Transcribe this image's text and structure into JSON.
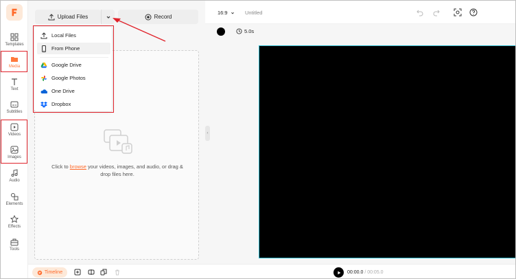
{
  "rail": {
    "items": [
      {
        "label": "Templates",
        "icon": "templates-icon"
      },
      {
        "label": "Media",
        "icon": "folder-icon"
      },
      {
        "label": "Text",
        "icon": "text-icon"
      },
      {
        "label": "Subtitles",
        "icon": "subtitles-icon"
      },
      {
        "label": "Videos",
        "icon": "video-icon"
      },
      {
        "label": "Images",
        "icon": "image-icon"
      },
      {
        "label": "Audio",
        "icon": "music-icon"
      },
      {
        "label": "Elements",
        "icon": "elements-icon"
      },
      {
        "label": "Effects",
        "icon": "effects-icon"
      },
      {
        "label": "Tools",
        "icon": "tools-icon"
      }
    ],
    "active": "Media"
  },
  "panel": {
    "upload_label": "Upload Files",
    "record_label": "Record",
    "drop_prefix": "Click to ",
    "drop_link": "browse",
    "drop_suffix": " your videos, images, and audio, or drag & drop files here."
  },
  "menu": {
    "items": [
      {
        "label": "Local Files",
        "icon": "upload-icon"
      },
      {
        "label": "From Phone",
        "icon": "phone-icon"
      },
      {
        "label": "Google Drive",
        "icon": "google-drive-icon"
      },
      {
        "label": "Google Photos",
        "icon": "google-photos-icon"
      },
      {
        "label": "One Drive",
        "icon": "onedrive-icon"
      },
      {
        "label": "Dropbox",
        "icon": "dropbox-icon"
      }
    ]
  },
  "topbar": {
    "ratio": "16:9",
    "project_name": "Untitled"
  },
  "editor": {
    "duration": "5.0s",
    "background_color": "#000000",
    "canvas_border_color": "#35c1d6"
  },
  "bottombar": {
    "timeline_label": "Timeline",
    "current_time": "00:00.0",
    "total_time": "/ 00:05.0"
  },
  "colors": {
    "accent": "#ff6a2a",
    "highlight": "#e0222a"
  }
}
